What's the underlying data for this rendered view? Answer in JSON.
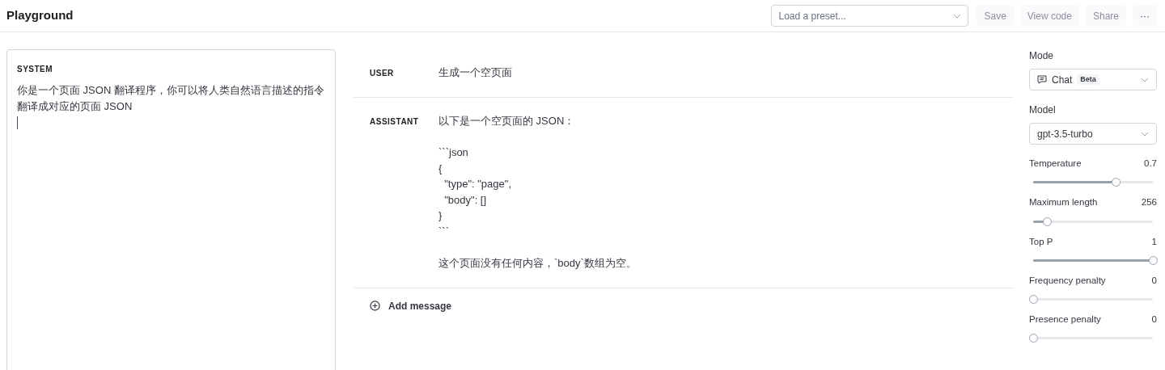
{
  "header": {
    "title": "Playground",
    "preset": {
      "placeholder": "Load a preset..."
    },
    "buttons": [
      {
        "label": "Save",
        "disabled": true
      },
      {
        "label": "View code",
        "disabled": true
      },
      {
        "label": "Share",
        "disabled": true
      },
      {
        "label": "···",
        "disabled": false
      }
    ]
  },
  "system": {
    "label": "SYSTEM",
    "value": "你是一个页面 JSON 翻译程序，你可以将人类自然语言描述的指令翻译成对应的页面 JSON"
  },
  "messages": [
    {
      "role": "USER",
      "paragraphs": [
        [
          "生成一个空页面"
        ]
      ]
    },
    {
      "role": "ASSISTANT",
      "paragraphs": [
        [
          "以下是一个空页面的 JSON："
        ],
        [
          "```json",
          "{",
          "  \"type\": \"page\",",
          "  \"body\": []",
          "}",
          "```"
        ],
        [
          "这个页面没有任何内容，`body`数组为空。"
        ]
      ]
    }
  ],
  "add_message": "Add message",
  "settings": {
    "mode": {
      "label": "Mode",
      "value": "Chat",
      "badge": "Beta"
    },
    "model": {
      "label": "Model",
      "value": "gpt-3.5-turbo"
    },
    "sliders": [
      {
        "label": "Temperature",
        "reading": "0.7",
        "level": 0.69
      },
      {
        "label": "Maximum length",
        "reading": "256",
        "level": 0.12
      },
      {
        "label": "Top P",
        "reading": "1",
        "level": 1
      },
      {
        "label": "Frequency penalty",
        "reading": "0",
        "level": 0
      },
      {
        "label": "Presence penalty",
        "reading": "0",
        "level": 0
      }
    ]
  }
}
